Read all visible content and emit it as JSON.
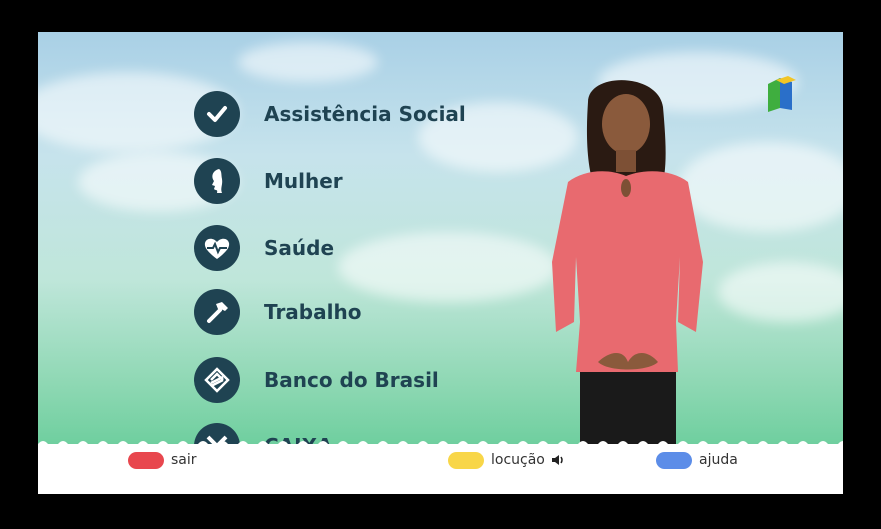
{
  "menu": {
    "items": [
      {
        "label": "Assistência Social",
        "icon": "check-icon"
      },
      {
        "label": "Mulher",
        "icon": "woman-profile-icon"
      },
      {
        "label": "Saúde",
        "icon": "heart-pulse-icon"
      },
      {
        "label": "Trabalho",
        "icon": "hammer-icon"
      },
      {
        "label": "Banco do Brasil",
        "icon": "banco-do-brasil-icon"
      },
      {
        "label": "CAIXA",
        "icon": "caixa-icon"
      }
    ]
  },
  "footer": {
    "exit": {
      "label": "sair",
      "color": "#e8474e"
    },
    "narration": {
      "label": "locução",
      "color": "#f8d648",
      "icon": "speaker-icon"
    },
    "help": {
      "label": "ajuda",
      "color": "#5c8de8"
    }
  },
  "colors": {
    "icon_bg": "#1f4352",
    "label_text": "#1f4352"
  }
}
